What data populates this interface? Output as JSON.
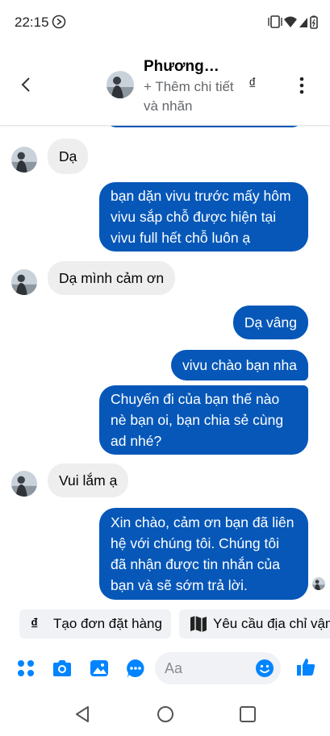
{
  "status": {
    "time": "22:15"
  },
  "header": {
    "name": "Phương…",
    "subtitle": "+ Thêm chi tiết và nhãn",
    "currency_symbol": "₫"
  },
  "messages": [
    {
      "direction": "in",
      "text": "Dạ"
    },
    {
      "direction": "out",
      "text": "bạn dặn vivu trước mấy hôm vivu sắp chỗ được hiện tại vivu full hết chỗ luôn ạ"
    },
    {
      "direction": "in",
      "text": "Dạ mình cảm ơn"
    },
    {
      "direction": "out",
      "text": "Dạ vâng"
    },
    {
      "direction": "out",
      "text": "vivu chào bạn nha"
    },
    {
      "direction": "out",
      "text": "Chuyến đi của bạn thế nào nè bạn oi, bạn chia sẻ cùng ad nhé?"
    },
    {
      "direction": "in",
      "text": "Vui lắm ạ"
    },
    {
      "direction": "out",
      "text": "Xin chào, cảm ơn bạn đã liên hệ với chúng tôi. Chúng tôi đã nhận được tin nhắn của bạn và sẽ sớm trả lời."
    }
  ],
  "quick_replies": [
    {
      "icon": "₫",
      "label": "Tạo đơn đặt hàng"
    },
    {
      "icon": "map-icon",
      "label": "Yêu cầu địa chỉ vận chuyển"
    }
  ],
  "composer": {
    "placeholder": "Aa"
  },
  "colors": {
    "accent": "#0084ff",
    "outgoing_bubble": "#0657b8",
    "incoming_bubble": "#eeeeee",
    "secondary_text": "#65676b"
  }
}
